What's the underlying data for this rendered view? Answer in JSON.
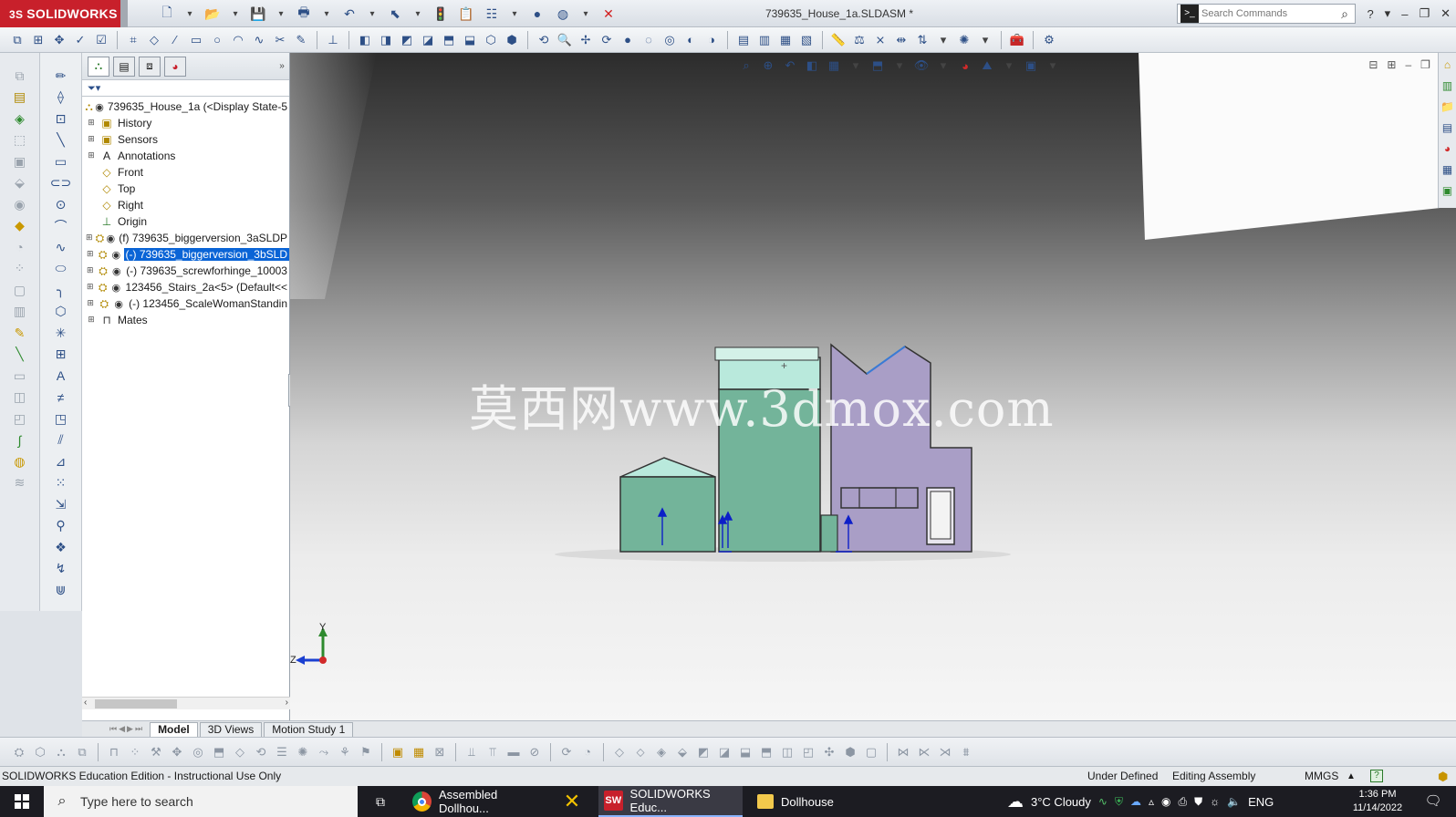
{
  "app": {
    "brand": "SOLIDWORKS",
    "brand_prefix": "3S",
    "doc_title": "739635_House_1a.SLDASM *"
  },
  "search": {
    "placeholder": "Search Commands"
  },
  "feature_manager": {
    "root": "739635_House_1a  (<Display State-5",
    "items": [
      {
        "label": "History",
        "type": "folder"
      },
      {
        "label": "Sensors",
        "type": "folder"
      },
      {
        "label": "Annotations",
        "type": "annotation"
      },
      {
        "label": "Front",
        "type": "plane"
      },
      {
        "label": "Top",
        "type": "plane"
      },
      {
        "label": "Right",
        "type": "plane"
      },
      {
        "label": "Origin",
        "type": "origin"
      },
      {
        "label": "(f) 739635_biggerversion_3aSLDP",
        "type": "part"
      },
      {
        "label": "(-) 739635_biggerversion_3bSLD",
        "type": "part",
        "selected": true
      },
      {
        "label": "(-) 739635_screwforhinge_10003",
        "type": "part"
      },
      {
        "label": "123456_Stairs_2a<5> (Default<<",
        "type": "part"
      },
      {
        "label": "(-) 123456_ScaleWomanStandin",
        "type": "part"
      },
      {
        "label": "Mates",
        "type": "mates"
      }
    ]
  },
  "bottom_tabs": [
    {
      "label": "Model",
      "active": true
    },
    {
      "label": "3D Views",
      "active": false
    },
    {
      "label": "Motion Study 1",
      "active": false
    }
  ],
  "viewport": {
    "watermark": "莫西网www.3dmox.com",
    "triad": {
      "y": "Y",
      "z": "Z"
    }
  },
  "status": {
    "edition": "SOLIDWORKS Education Edition - Instructional Use Only",
    "definition": "Under Defined",
    "mode": "Editing Assembly",
    "units": "MMGS",
    "units_arrow": "▲"
  },
  "taskbar": {
    "search_placeholder": "Type here to search",
    "apps": [
      {
        "label": "Assembled Dollhou...",
        "icon": "chrome-icon",
        "active": false
      },
      {
        "label": "",
        "icon": "x-app-icon",
        "active": false
      },
      {
        "label": "SOLIDWORKS Educ...",
        "icon": "solidworks-icon",
        "active": true
      },
      {
        "label": "Dollhouse",
        "icon": "folder-icon",
        "active": false
      }
    ],
    "weather": "3°C  Cloudy",
    "language": "ENG",
    "time": "1:36 PM",
    "date": "11/14/2022"
  },
  "colors": {
    "accent": "#c8202b",
    "selection": "#0a64d6",
    "house_green": "#73b49a",
    "house_roof": "#b9e9dc",
    "house_purple": "#a99ec6",
    "mate_blue": "#0d1fc8"
  }
}
